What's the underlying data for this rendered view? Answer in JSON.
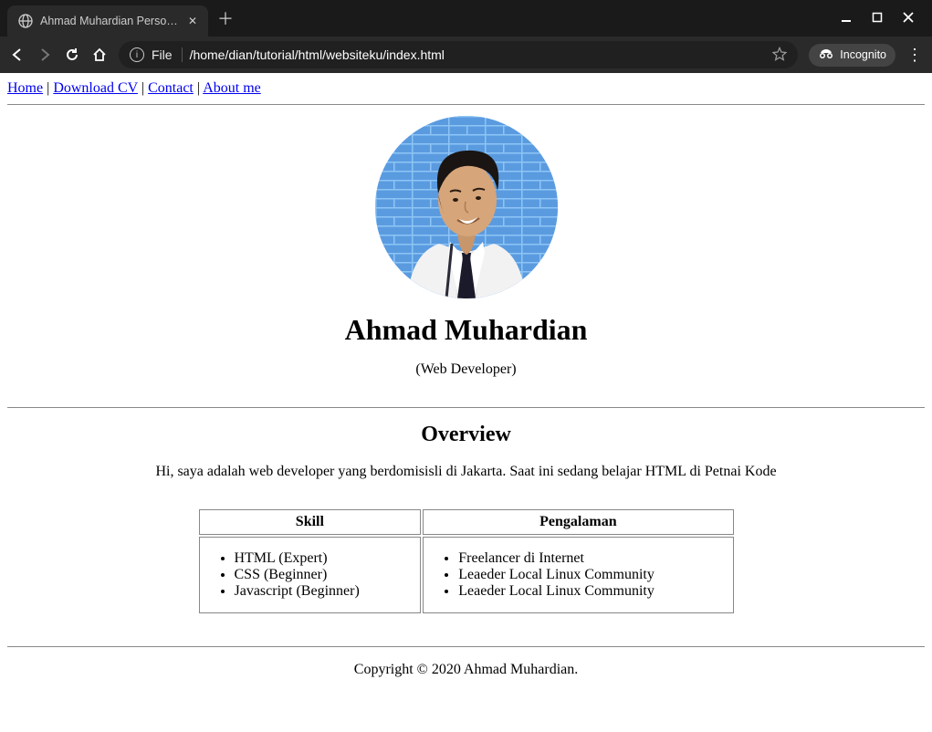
{
  "browser": {
    "tab_title": "Ahmad Muhardian Personal W",
    "url": "/home/dian/tutorial/html/websiteku/index.html",
    "file_label": "File",
    "incognito": "Incognito"
  },
  "nav": {
    "items": [
      "Home",
      "Download CV",
      "Contact",
      "About me"
    ],
    "sep": " | "
  },
  "hero": {
    "name": "Ahmad Muhardian",
    "subtitle": "(Web Developer)"
  },
  "overview": {
    "heading": "Overview",
    "text": "Hi, saya adalah web developer yang berdomisisli di Jakarta. Saat ini sedang belajar HTML di Petnai Kode",
    "headers": [
      "Skill",
      "Pengalaman"
    ],
    "skills": [
      "HTML (Expert)",
      "CSS (Beginner)",
      "Javascript (Beginner)"
    ],
    "experience": [
      "Freelancer di Internet",
      "Leaeder Local Linux Community",
      "Leaeder Local Linux Community"
    ]
  },
  "footer": {
    "text": "Copyright © 2020 Ahmad Muhardian."
  }
}
